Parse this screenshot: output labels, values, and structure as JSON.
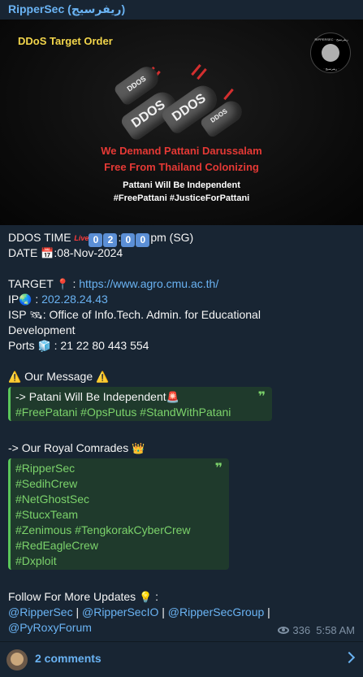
{
  "channel": {
    "name": "RipperSec (ريفرسيج)"
  },
  "banner": {
    "label": "DDoS Target Order",
    "logo_text_top": "RIPPERSEC · ريفرسيج",
    "logo_text_bottom": "· ريفرسيج ·",
    "bomb_texts": [
      "DDOS",
      "DDOS",
      "DDOS",
      "DDOS"
    ],
    "demand_line1": "We Demand Pattani Darussalam",
    "demand_line2": "Free From Thailand Colonizing",
    "independent": "Pattani Will Be Independent",
    "hashtags": "#FreePattani #JusticeForPattani"
  },
  "post": {
    "time_label": "DDOS TIME",
    "live_badge": "Live",
    "time_digits": [
      "0",
      "2",
      "0",
      "0"
    ],
    "time_suffix": "pm (SG)",
    "date_label": "DATE",
    "date_value": ":08-Nov-2024",
    "target_label": "TARGET",
    "target_sep": ":",
    "target_url": "https://www.agro.cmu.ac.th/",
    "ip_label": "IP",
    "ip_sep": ":",
    "ip_value": "202.28.24.43",
    "isp_label": "ISP",
    "isp_value_line1": ": Office of Info.Tech. Admin. for Educational",
    "isp_value_line2": "Development",
    "ports_label": "Ports",
    "ports_value": ": 21 22 80 443 554",
    "message_heading": "Our Message",
    "message_quote_line1": "-> Patani Will Be Independent",
    "message_quote_line2": "#FreePatani #OpsPutus #StandWithPatani",
    "comrades_heading": "-> Our Royal Comrades",
    "comrades": [
      "#RipperSec",
      "#SedihCrew",
      "#NetGhostSec",
      "#StucxTeam",
      "#Zenimous #TengkorakCyberCrew",
      "#RedEagleCrew",
      "#Dxploit"
    ],
    "follow_heading": "Follow For More Updates",
    "follow_sep": ":",
    "links_line1": [
      "@RipperSec",
      "@RipperSecIO",
      "@RipperSecGroup"
    ],
    "link_separator": "|",
    "links_line2": "@PyRoxyForum",
    "views": "336",
    "time": "5:58 AM"
  },
  "comments": {
    "label": "2 comments"
  },
  "icons": {
    "calendar": "calendar-icon",
    "pin": "pushpin-icon",
    "globe": "globe-icon",
    "satellite": "satellite-icon",
    "cube": "cube-icon",
    "warning": "warning-icon",
    "siren": "siren-icon",
    "crown": "crown-icon",
    "lightbulb": "lightbulb-icon",
    "eye": "eye-icon",
    "chevron": "chevron-right-icon"
  },
  "colors": {
    "link": "#6ab3f3",
    "quote_green": "#7cd36b",
    "banner_red": "#e53935",
    "banner_yellow": "#f2d54b"
  }
}
